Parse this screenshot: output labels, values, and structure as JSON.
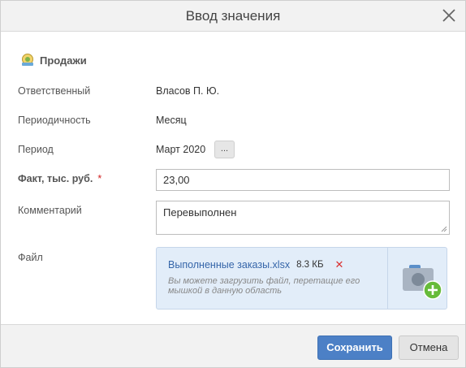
{
  "dialog": {
    "title": "Ввод значения"
  },
  "section": {
    "title": "Продажи",
    "icon": "sales-indicator-icon"
  },
  "fields": {
    "responsible": {
      "label": "Ответственный",
      "value": "Власов П. Ю."
    },
    "periodicity": {
      "label": "Периодичность",
      "value": "Месяц"
    },
    "period": {
      "label": "Период",
      "value": "Март 2020",
      "button_label": "..."
    },
    "fact": {
      "label": "Факт, тыс. руб.",
      "required_mark": "*",
      "value": "23,00"
    },
    "comment": {
      "label": "Комментарий",
      "value": "Перевыполнен"
    },
    "file": {
      "label": "Файл",
      "name": "Выполненные заказы.xlsx",
      "size": "8.3 КБ",
      "remove_label": "✕",
      "hint": "Вы можете загрузить файл, перетащие его мышкой в данную область"
    }
  },
  "footer": {
    "save_label": "Сохранить",
    "cancel_label": "Отмена"
  },
  "colors": {
    "accent": "#4c80c6",
    "link": "#3565a9",
    "required": "#d02020",
    "dropzone": "#e2edf9",
    "add": "#66bb3a"
  }
}
